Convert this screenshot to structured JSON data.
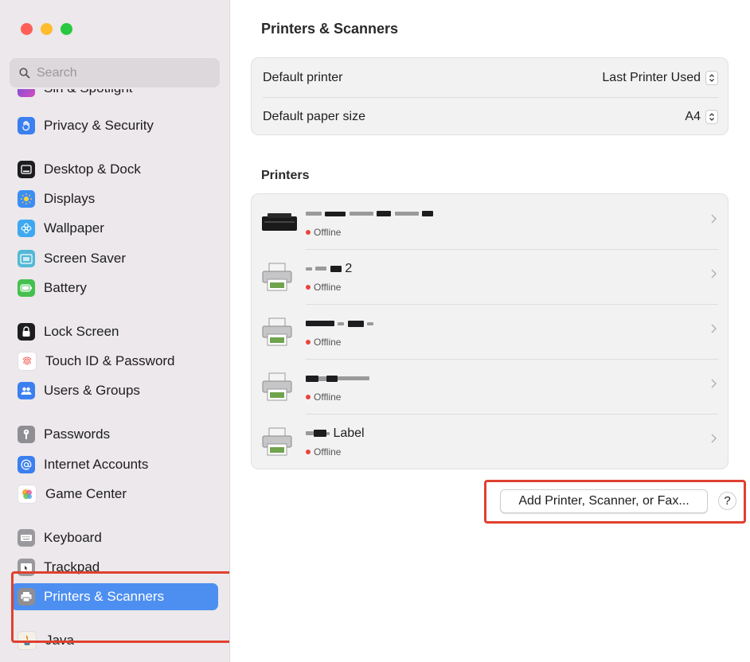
{
  "sidebar": {
    "search_placeholder": "Search",
    "partial_top_label": "Siri & Spotlight",
    "items": [
      {
        "label": "Privacy & Security",
        "icon": "hand-icon",
        "color": "#3b7ff0"
      },
      {
        "label": "Desktop & Dock",
        "icon": "dock-icon",
        "color": "#1d1d1f"
      },
      {
        "label": "Displays",
        "icon": "sun-icon",
        "color": "#3b8ef3"
      },
      {
        "label": "Wallpaper",
        "icon": "flower-icon",
        "color": "#3ea8f0"
      },
      {
        "label": "Screen Saver",
        "icon": "screensaver-icon",
        "color": "#53b8d6"
      },
      {
        "label": "Battery",
        "icon": "battery-icon",
        "color": "#45c04f"
      },
      {
        "label": "Lock Screen",
        "icon": "lock-icon",
        "color": "#1d1d1f"
      },
      {
        "label": "Touch ID & Password",
        "icon": "fingerprint-icon",
        "color": "#ef5b55"
      },
      {
        "label": "Users & Groups",
        "icon": "users-icon",
        "color": "#3b7ff0"
      },
      {
        "label": "Passwords",
        "icon": "key-icon",
        "color": "#8e8e93"
      },
      {
        "label": "Internet Accounts",
        "icon": "at-icon",
        "color": "#3b7ff0"
      },
      {
        "label": "Game Center",
        "icon": "game-center-icon",
        "color": "#e45a9b"
      },
      {
        "label": "Keyboard",
        "icon": "keyboard-icon",
        "color": "#9a9a9e"
      },
      {
        "label": "Trackpad",
        "icon": "trackpad-icon",
        "color": "#9a9a9e"
      },
      {
        "label": "Printers & Scanners",
        "icon": "printer-icon",
        "color": "#8e8e93",
        "active": true
      },
      {
        "label": "Java",
        "icon": "java-icon",
        "color": "#f5f0e6"
      }
    ]
  },
  "main": {
    "title": "Printers & Scanners",
    "settings": [
      {
        "label": "Default printer",
        "value": "Last Printer Used"
      },
      {
        "label": "Default paper size",
        "value": "A4"
      }
    ],
    "printers_title": "Printers",
    "printers": [
      {
        "name_fragment": "",
        "status": "Offline",
        "icon": "inkjet-printer-icon"
      },
      {
        "name_fragment": "2",
        "status": "Offline",
        "icon": "printer-icon"
      },
      {
        "name_fragment": "",
        "status": "Offline",
        "icon": "printer-icon"
      },
      {
        "name_fragment": "",
        "status": "Offline",
        "icon": "printer-icon"
      },
      {
        "name_fragment": "Label",
        "status": "Offline",
        "icon": "printer-icon"
      }
    ],
    "add_button": "Add Printer, Scanner, or Fax...",
    "help_button": "?"
  },
  "colors": {
    "accent": "#4d8ff1",
    "highlight": "#e0402f",
    "offline": "#e8453c"
  }
}
